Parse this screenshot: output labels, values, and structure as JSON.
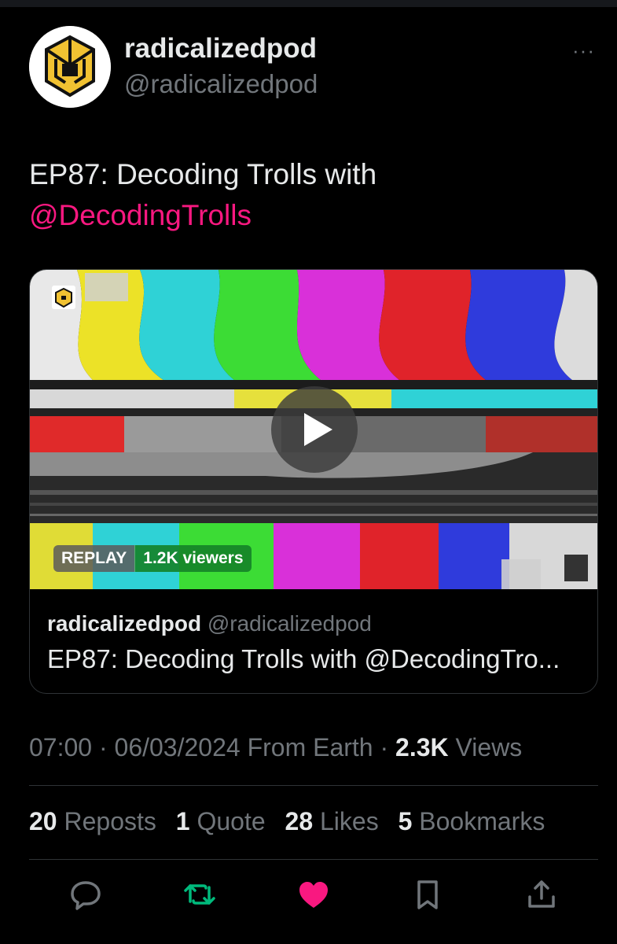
{
  "author": {
    "display_name": "radicalizedpod",
    "handle": "@radicalizedpod",
    "avatar_icon": "radicalized-logo-icon"
  },
  "tweet": {
    "text_line1": "EP87: Decoding Trolls with",
    "mention": "@DecodingTrolls"
  },
  "card": {
    "replay_label": "REPLAY",
    "viewers_label": "1.2K viewers",
    "author_name": "radicalizedpod",
    "author_handle": "@radicalizedpod",
    "title": "EP87: Decoding Trolls with @DecodingTro..."
  },
  "meta": {
    "time": "07:00",
    "date": "06/03/2024",
    "location": "From Earth",
    "views_count": "2.3K",
    "views_label": "Views"
  },
  "stats": {
    "reposts_count": "20",
    "reposts_label": "Reposts",
    "quotes_count": "1",
    "quotes_label": "Quote",
    "likes_count": "28",
    "likes_label": "Likes",
    "bookmarks_count": "5",
    "bookmarks_label": "Bookmarks"
  },
  "colors": {
    "background": "#000000",
    "text": "#e7e9ea",
    "muted": "#71767b",
    "mention": "#f91880",
    "like": "#f91880",
    "repost": "#00ba7c",
    "divider": "#2f3336"
  },
  "actions": [
    "reply-icon",
    "repost-icon",
    "like-icon",
    "bookmark-icon",
    "share-icon"
  ]
}
